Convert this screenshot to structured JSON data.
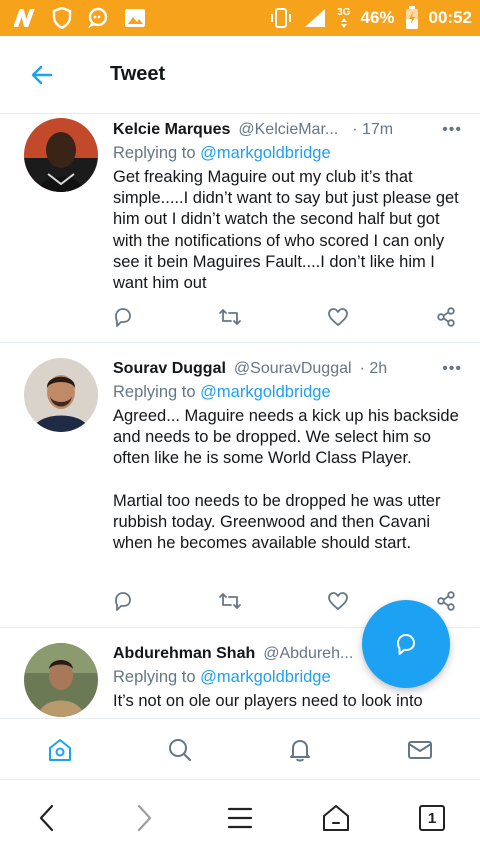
{
  "status_bar": {
    "network": "3G",
    "battery": "46%",
    "time": "00:52"
  },
  "header": {
    "title": "Tweet",
    "back_icon": "arrow-left-icon"
  },
  "tweets": [
    {
      "name": "Kelcie Marques",
      "handle": "@KelcieMar...",
      "time": "· 17m",
      "replying_prefix": "Replying to",
      "replying_to": "@markgoldbridge",
      "paragraphs": [
        "Get freaking Maguire out my club it’s that simple.....I didn’t want to say but just please get him out I didn’t watch the second half but got with the notifications of who scored I can only see it bein Maguires Fault....I don’t like him I want him out"
      ]
    },
    {
      "name": "Sourav Duggal",
      "handle": "@SouravDuggal",
      "time": "· 2h",
      "replying_prefix": "Replying to",
      "replying_to": "@markgoldbridge",
      "paragraphs": [
        "Agreed... Maguire needs a kick up his backside and needs to be dropped. We select him so often like he is some World Class Player.",
        "Martial too needs to be dropped he was utter rubbish today. Greenwood and then Cavani when he becomes available should start."
      ]
    },
    {
      "name": "Abdurehman Shah",
      "handle": "@Abdureh...",
      "time": "",
      "replying_prefix": "Replying to",
      "replying_to": "@markgoldbridge",
      "paragraphs": [
        "It’s not on ole our players need to look into"
      ]
    }
  ],
  "more_label": "•••",
  "fab_icon": "compose-reply-icon",
  "bottom_nav": [
    "home-icon",
    "search-icon",
    "notifications-icon",
    "messages-icon"
  ],
  "browser_bar": {
    "tab_count": "1"
  },
  "colors": {
    "status_bar": "#f7a21b",
    "accent": "#1da1f2",
    "secondary_text": "#657786"
  }
}
